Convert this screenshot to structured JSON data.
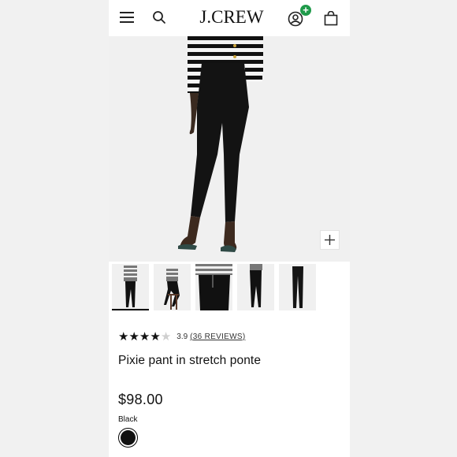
{
  "header": {
    "logo_text": "J.CREW",
    "account_badge": "+",
    "badge_color": "#1f9a4a"
  },
  "icons": {
    "menu": "hamburger-icon",
    "search": "search-icon",
    "account": "account-icon",
    "bag": "shopping-bag-icon",
    "zoom": "plus-icon"
  },
  "gallery": {
    "thumbnail_count": 5,
    "selected_index": 0
  },
  "product": {
    "rating": 3.9,
    "rating_text": "3.9",
    "reviews_text": "(36 REVIEWS)",
    "name": "Pixie pant in stretch ponte",
    "price": "$98.00",
    "color_label": "Black",
    "swatch_color": "#111111"
  }
}
